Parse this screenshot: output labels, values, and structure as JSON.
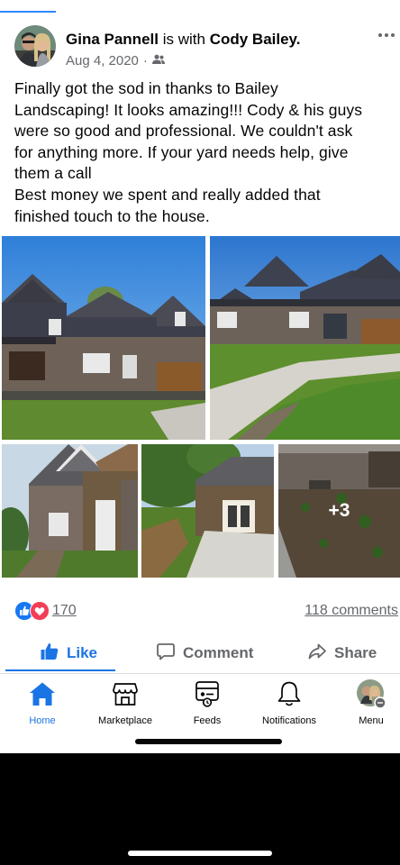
{
  "post": {
    "author": "Gina Pannell",
    "with_text": "is with",
    "tagged": "Cody Bailey.",
    "date": "Aug 4, 2020",
    "separator": "·",
    "audience_icon": "friends-icon",
    "more_icon": "more-icon",
    "text_lines": [
      "Finally got the sod in thanks to Bailey",
      "Landscaping! It looks amazing!!! Cody & his guys",
      "were so good and professional. We couldn't ask",
      "for anything more. If your yard needs help, give",
      "them a call",
      "Best money we spent and really added that",
      "finished touch to the house."
    ],
    "photos": {
      "more_count": "+3"
    },
    "reactions": {
      "icons": [
        "like-reaction-icon",
        "love-reaction-icon"
      ],
      "count": "170"
    },
    "comments_label": "118 comments"
  },
  "actions": {
    "like": "Like",
    "comment": "Comment",
    "share": "Share"
  },
  "tabbar": {
    "items": [
      {
        "label": "Home",
        "icon": "home-icon",
        "active": true
      },
      {
        "label": "Marketplace",
        "icon": "marketplace-icon",
        "active": false
      },
      {
        "label": "Feeds",
        "icon": "feeds-icon",
        "active": false
      },
      {
        "label": "Notifications",
        "icon": "bell-icon",
        "active": false
      },
      {
        "label": "Menu",
        "icon": "profile-menu-icon",
        "active": false
      }
    ]
  },
  "colors": {
    "accent": "#1b74e4",
    "secondary_text": "#65676b",
    "like_reaction": "#1877f2",
    "love_reaction": "#f33e58"
  }
}
